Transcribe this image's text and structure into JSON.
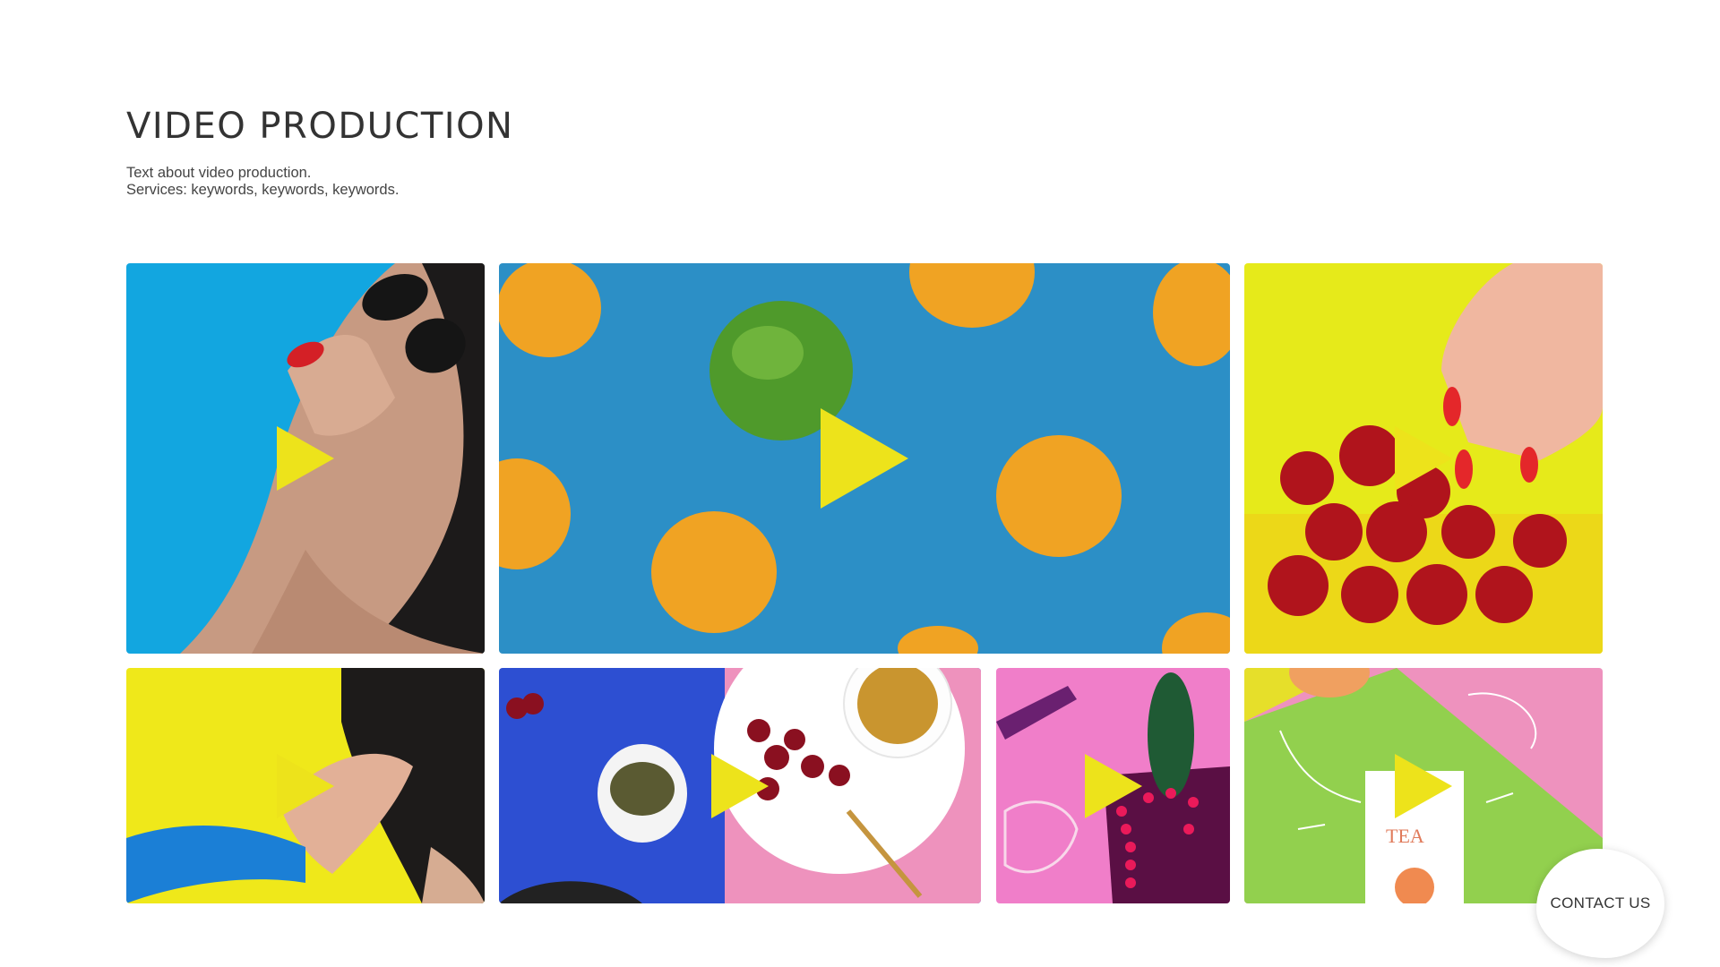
{
  "section": {
    "title": "VIDEO PRODUCTION",
    "description_line1": "Text about video production.",
    "description_line2": "Services: keywords, keywords, keywords."
  },
  "videos": [
    {
      "subject": "woman-sunglasses",
      "play_icon": "play-icon"
    },
    {
      "subject": "apricots-lime",
      "play_icon": "play-icon"
    },
    {
      "subject": "hand-cherries",
      "play_icon": "play-icon"
    },
    {
      "subject": "woman-hair-yellow",
      "play_icon": "play-icon"
    },
    {
      "subject": "tea-cherries-table",
      "play_icon": "play-icon"
    },
    {
      "subject": "cactus-pink",
      "play_icon": "play-icon"
    },
    {
      "subject": "tea-package",
      "play_icon": "play-icon"
    }
  ],
  "contact_button": {
    "label": "CONTACT US"
  },
  "colors": {
    "play_accent": "#ede31b",
    "title_text": "#333333"
  }
}
